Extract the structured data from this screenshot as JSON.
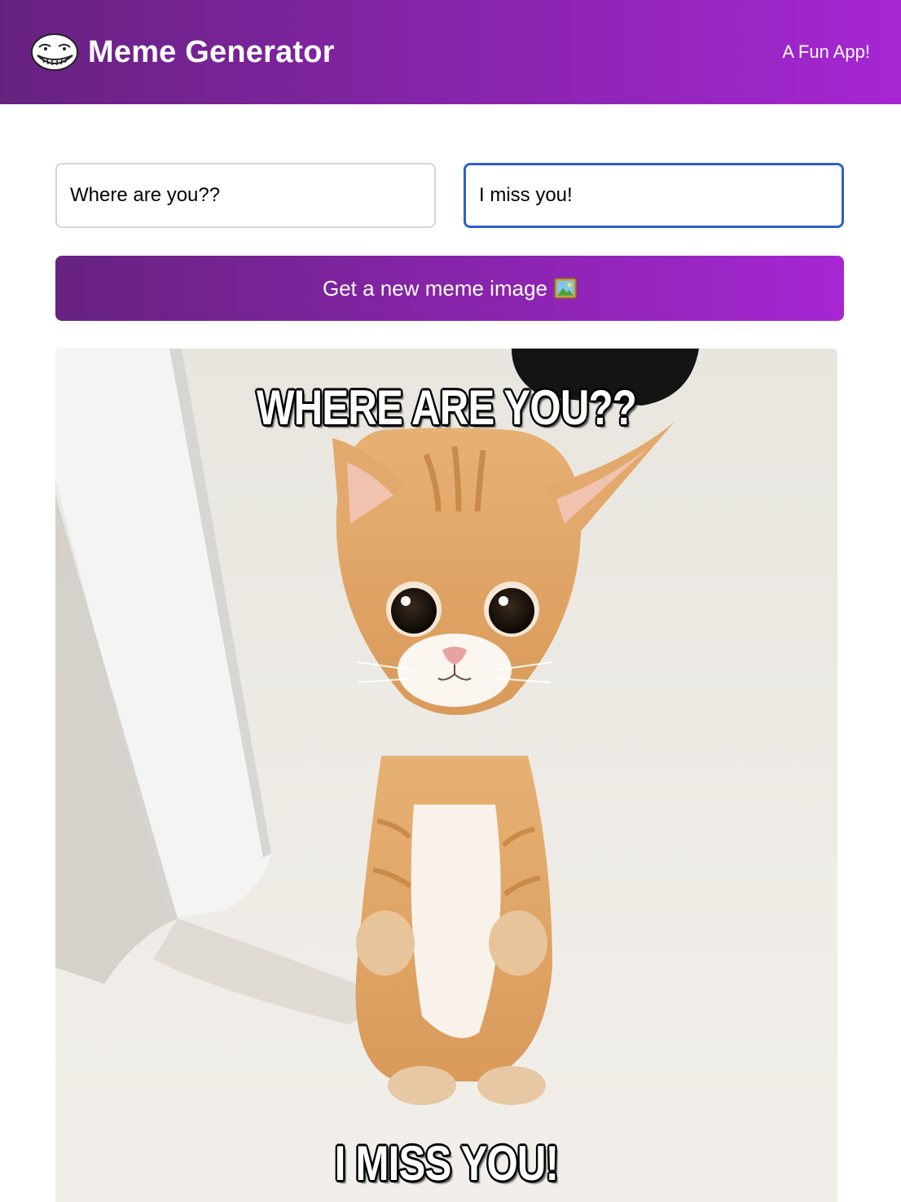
{
  "header": {
    "title": "Meme Generator",
    "tagline": "A Fun App!",
    "logo_icon": "troll-face-icon",
    "gradient_start": "#672280",
    "gradient_end": "#A626D3"
  },
  "form": {
    "top_text_value": "Where are you??",
    "bottom_text_value": "I miss you!",
    "focused_field": "bottom_text",
    "focus_color": "#2F5FC8"
  },
  "button": {
    "label": "Get a new meme image",
    "icon": "picture-frame-icon"
  },
  "meme": {
    "top_text": "Where are you??",
    "bottom_text": "I miss you!",
    "image_subject": "orange-kitten-standing"
  }
}
